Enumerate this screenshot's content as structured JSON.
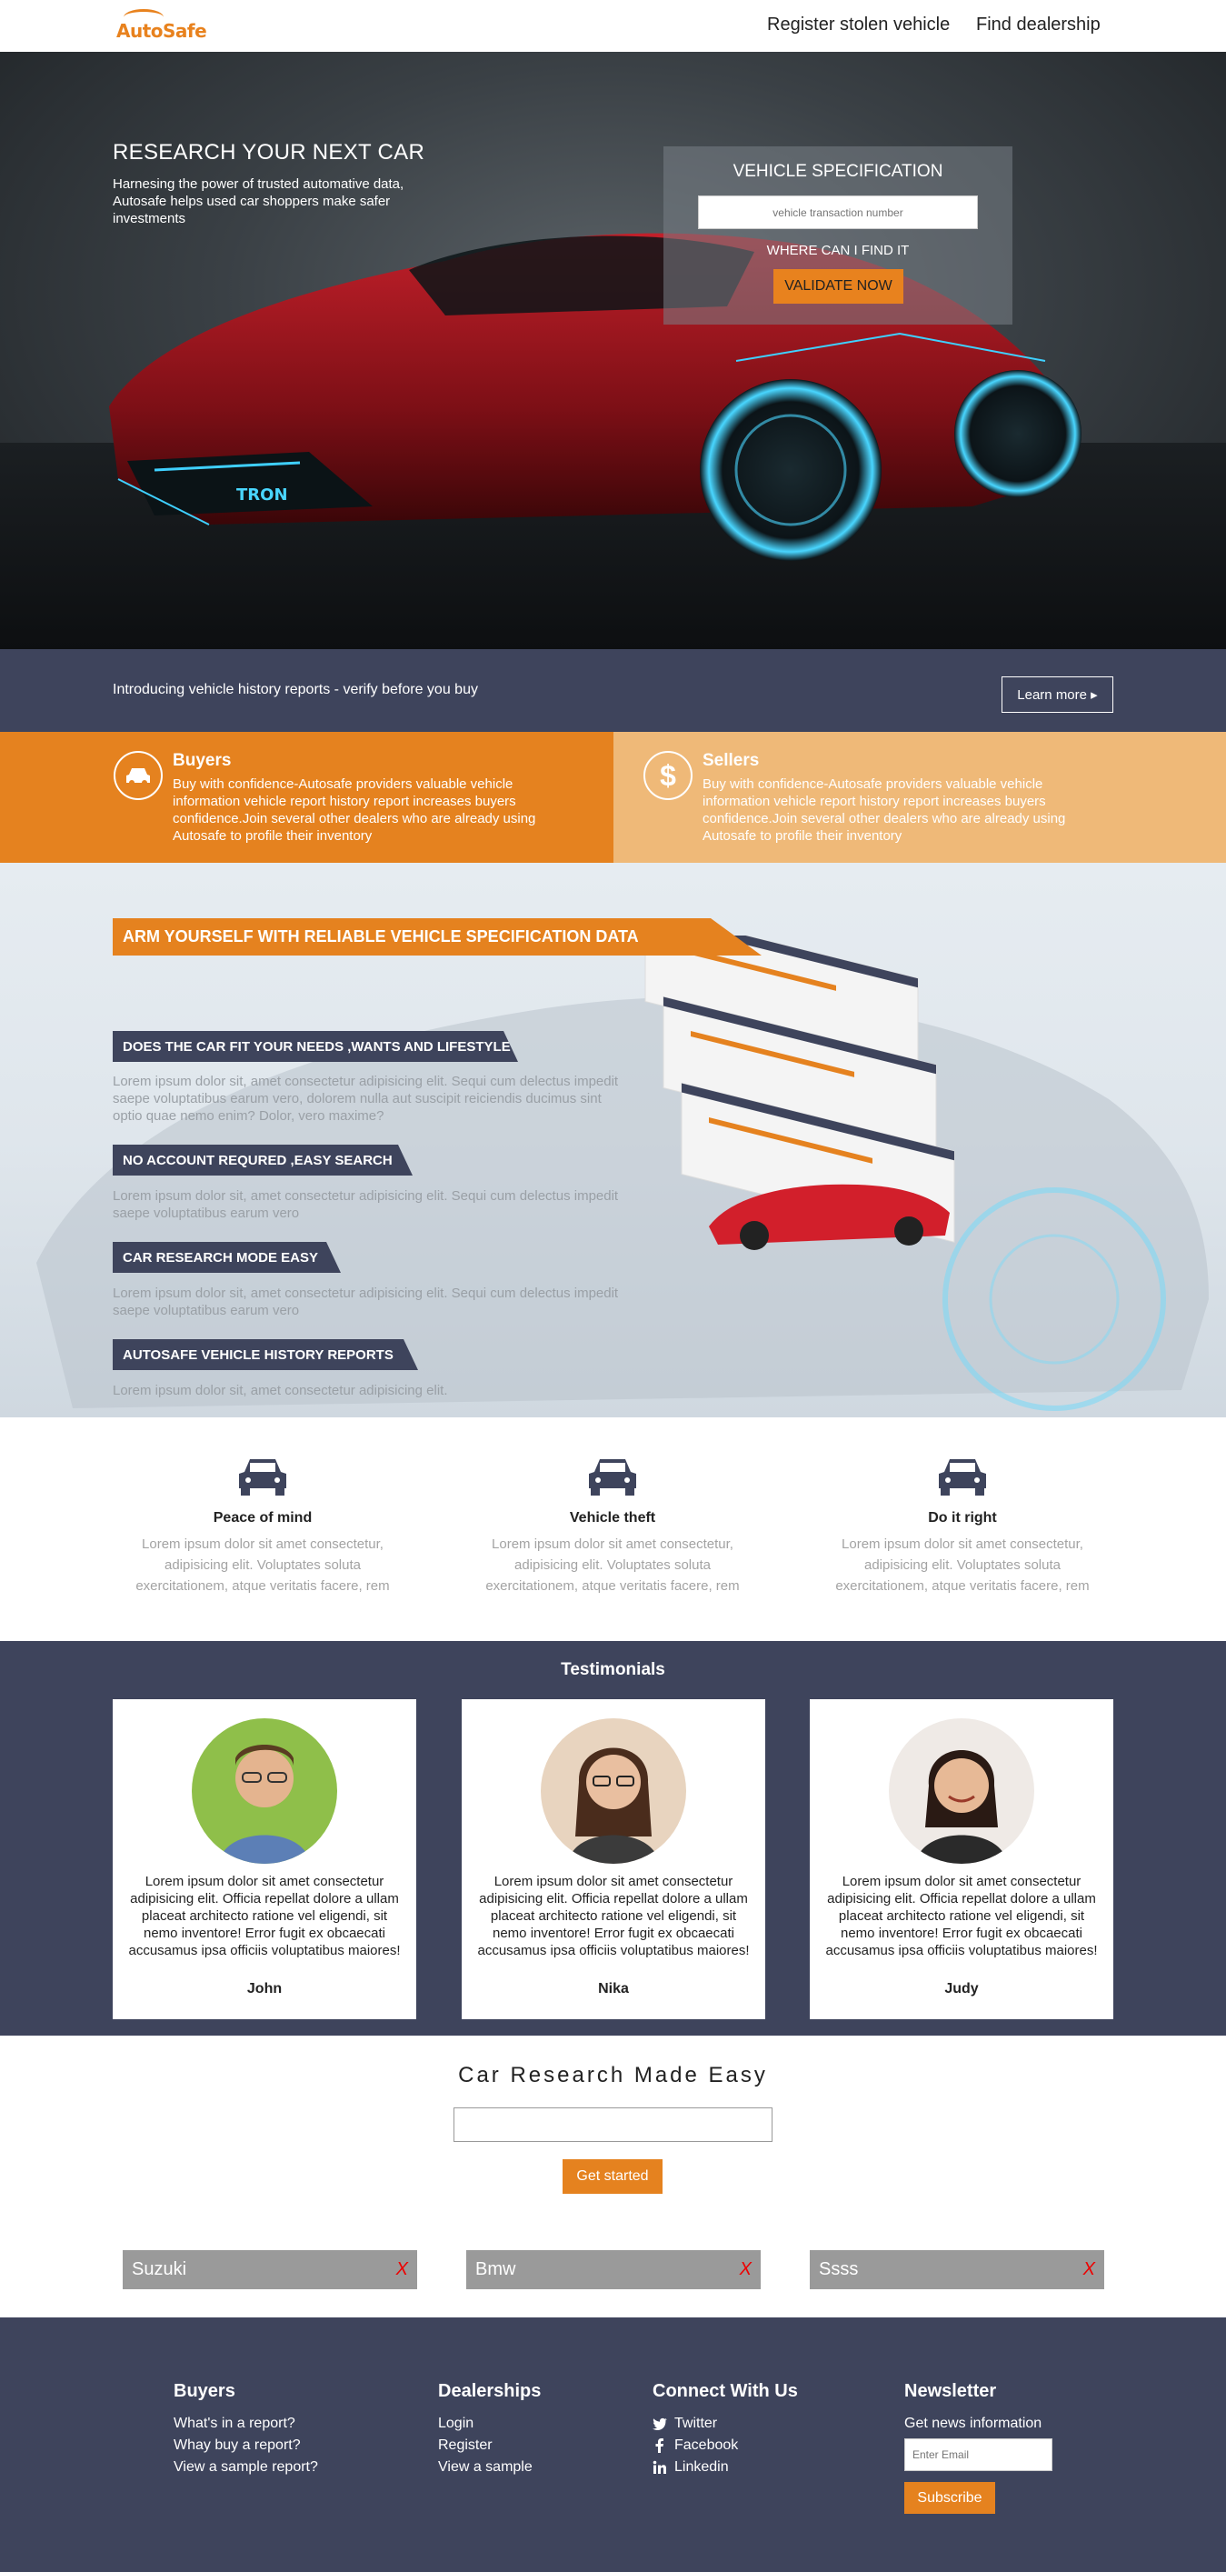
{
  "nav": {
    "logo_text": "AutoSafe",
    "links": [
      "Register stolen vehicle",
      "Find dealership"
    ]
  },
  "hero": {
    "title": "RESEARCH YOUR NEXT CAR",
    "subtitle": "Harnesing the power of trusted automative data, Autosafe helps used car shoppers make safer investments",
    "plate_text": "TRON",
    "spec_box": {
      "title": "VEHICLE SPECIFICATION",
      "input_placeholder": "vehicle transaction number",
      "find_text": "WHERE CAN I FIND IT",
      "button": "VALIDATE NOW"
    }
  },
  "intro": {
    "text": "Introducing vehicle history reports - verify before you buy",
    "button": "Learn more"
  },
  "buyers": {
    "icon": "car-icon",
    "title": "Buyers",
    "text": "Buy with confidence-Autosafe providers valuable vehicle information vehicle report history report increases buyers confidence.Join several other dealers who are already using Autosafe to profile their inventory"
  },
  "sellers": {
    "icon": "dollar-icon",
    "title": "Sellers",
    "text": "Buy with confidence-Autosafe providers valuable vehicle information vehicle report history report increases buyers confidence.Join several other dealers who are already using Autosafe to profile their inventory"
  },
  "arm": {
    "banner": "ARM YOURSELF WITH RELIABLE VEHICLE SPECIFICATION DATA",
    "items": [
      {
        "tag": "DOES THE CAR FIT YOUR NEEDS ,WANTS AND LIFESTYLE?",
        "text": "Lorem ipsum dolor sit, amet consectetur adipisicing elit. Sequi cum delectus impedit saepe voluptatibus earum vero, dolorem nulla aut suscipit reiciendis ducimus sint optio quae nemo enim? Dolor, vero maxime?"
      },
      {
        "tag": "NO ACCOUNT REQURED ,EASY SEARCH",
        "text": "Lorem ipsum dolor sit, amet consectetur adipisicing elit. Sequi cum delectus impedit saepe voluptatibus earum vero"
      },
      {
        "tag": "CAR RESEARCH MODE EASY",
        "text": "Lorem ipsum dolor sit, amet consectetur adipisicing elit. Sequi cum delectus impedit saepe voluptatibus earum vero"
      },
      {
        "tag": "AUTOSAFE VEHICLE HISTORY REPORTS",
        "text": "Lorem ipsum dolor sit, amet consectetur adipisicing elit."
      }
    ]
  },
  "features": [
    {
      "title": "Peace of mind",
      "text": "Lorem ipsum dolor sit amet consectetur, adipisicing elit. Voluptates soluta exercitationem, atque veritatis facere, rem"
    },
    {
      "title": "Vehicle theft",
      "text": "Lorem ipsum dolor sit amet consectetur, adipisicing elit. Voluptates soluta exercitationem, atque veritatis facere, rem"
    },
    {
      "title": "Do it right",
      "text": "Lorem ipsum dolor sit amet consectetur, adipisicing elit. Voluptates soluta exercitationem, atque veritatis facere, rem"
    }
  ],
  "testimonials": {
    "title": "Testimonials",
    "cards": [
      {
        "name": "John",
        "quote": "Lorem ipsum dolor sit amet consectetur adipisicing elit. Officia repellat dolore a ullam placeat architecto ratione vel eligendi, sit nemo inventore! Error fugit ex obcaecati accusamus ipsa officiis voluptatibus maiores!"
      },
      {
        "name": "Nika",
        "quote": "Lorem ipsum dolor sit amet consectetur adipisicing elit. Officia repellat dolore a ullam placeat architecto ratione vel eligendi, sit nemo inventore! Error fugit ex obcaecati accusamus ipsa officiis voluptatibus maiores!"
      },
      {
        "name": "Judy",
        "quote": "Lorem ipsum dolor sit amet consectetur adipisicing elit. Officia repellat dolore a ullam placeat architecto ratione vel eligendi, sit nemo inventore! Error fugit ex obcaecati accusamus ipsa officiis voluptatibus maiores!"
      }
    ]
  },
  "research": {
    "title": "Car Research Made Easy",
    "input_value": "",
    "button": "Get started",
    "chips": [
      {
        "label": "Suzuki",
        "remove": "X"
      },
      {
        "label": "Bmw",
        "remove": "X"
      },
      {
        "label": "Ssss",
        "remove": "X"
      }
    ]
  },
  "footer": {
    "buyers": {
      "title": "Buyers",
      "links": [
        "What's in a report?",
        "Whay buy a report?",
        "View a sample report?"
      ]
    },
    "dealerships": {
      "title": "Dealerships",
      "links": [
        "Login",
        "Register",
        "View a sample"
      ]
    },
    "connect": {
      "title": "Connect With Us",
      "links": [
        "Twitter",
        "Facebook",
        "Linkedin"
      ]
    },
    "newsletter": {
      "title": "Newsletter",
      "label": "Get news information",
      "placeholder": "Enter Email",
      "button": "Subscribe"
    }
  },
  "colors": {
    "accent": "#e5821f",
    "navy": "#3e445c",
    "peach": "#efb978"
  }
}
